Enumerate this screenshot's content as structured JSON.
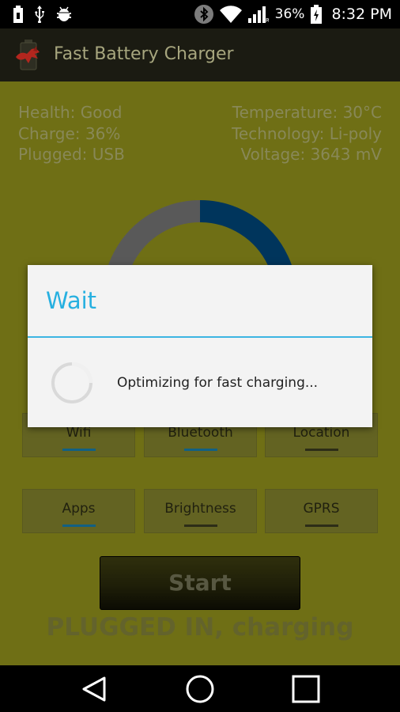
{
  "status_bar": {
    "battery_percent": "36%",
    "time": "8:32 PM",
    "left_icons": [
      "usb-battery-icon",
      "usb-icon",
      "android-debug-icon"
    ],
    "right_icons": [
      "bluetooth-icon",
      "wifi-icon",
      "signal-icon",
      "battery-charging-icon"
    ]
  },
  "app_bar": {
    "title": "Fast Battery Charger",
    "icon": "app-logo-icon"
  },
  "info": {
    "health": "Health: Good",
    "charge": "Charge: 36%",
    "plugged": "Plugged: USB",
    "temperature": "Temperature: 30°C",
    "technology": "Technology: Li-poly",
    "voltage": "Voltage: 3643 mV"
  },
  "gauge": {
    "charge_fraction": 0.36,
    "fill_color": "#004a80",
    "track_color": "#7c7c7c"
  },
  "toggles": [
    {
      "label": "Wifi",
      "on": true
    },
    {
      "label": "Bluetooth",
      "on": true
    },
    {
      "label": "Location",
      "on": false
    },
    {
      "label": "Apps",
      "on": true
    },
    {
      "label": "Brightness",
      "on": false
    },
    {
      "label": "GPRS",
      "on": false
    }
  ],
  "start_label": "Start",
  "plug_status": "PLUGGED IN, charging",
  "dialog": {
    "title": "Wait",
    "message": "Optimizing for fast charging..."
  },
  "colors": {
    "background": "#9a9a1e",
    "accent": "#27b0e0",
    "toggle_on": "#1a86b6"
  },
  "nav_icons": [
    "back-icon",
    "home-icon",
    "recents-icon"
  ]
}
